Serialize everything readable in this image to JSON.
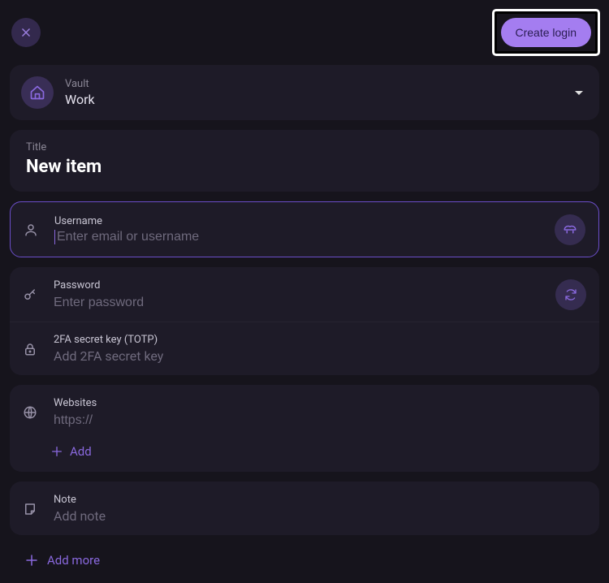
{
  "header": {
    "create_login_label": "Create login"
  },
  "vault": {
    "label": "Vault",
    "value": "Work"
  },
  "title": {
    "label": "Title",
    "value": "New item"
  },
  "username": {
    "label": "Username",
    "placeholder": "Enter email or username",
    "value": ""
  },
  "password": {
    "label": "Password",
    "placeholder": "Enter password",
    "value": ""
  },
  "totp": {
    "label": "2FA secret key (TOTP)",
    "placeholder": "Add 2FA secret key"
  },
  "websites": {
    "label": "Websites",
    "placeholder": "https://",
    "add_label": "Add"
  },
  "note": {
    "label": "Note",
    "placeholder": "Add note"
  },
  "add_more_label": "Add more"
}
